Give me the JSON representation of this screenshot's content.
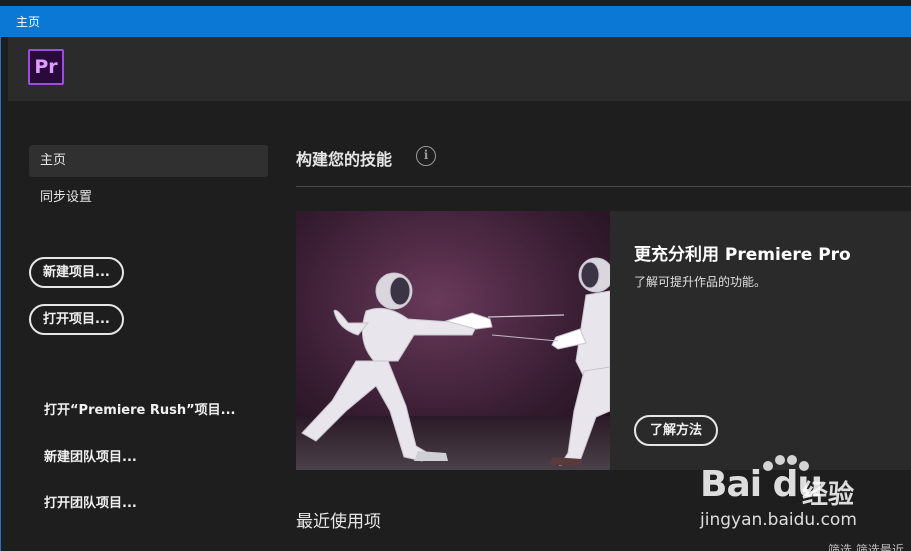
{
  "window": {
    "title": "主页"
  },
  "app": {
    "logo_text": "Pr"
  },
  "sidebar": {
    "items": [
      {
        "label": "主页",
        "active": true
      },
      {
        "label": "同步设置",
        "active": false
      }
    ],
    "buttons": [
      {
        "label": "新建项目..."
      },
      {
        "label": "打开项目..."
      }
    ],
    "links": [
      {
        "label": "打开“Premiere Rush”项目..."
      },
      {
        "label": "新建团队项目..."
      },
      {
        "label": "打开团队项目..."
      }
    ]
  },
  "main": {
    "section_title": "构建您的技能",
    "info_icon": "info-icon",
    "card": {
      "title": "更充分利用 Premiere Pro",
      "description": "了解可提升作品的功能。",
      "button_label": "了解方法"
    },
    "recent_title": "最近使用项",
    "filter_text": "筛选 筛选最近"
  },
  "watermark": {
    "brand": "Bai du",
    "product": "经验",
    "url": "jingyan.baidu.com"
  },
  "colors": {
    "titlebar": "#0a78d4",
    "background": "#1e1e1e",
    "header": "#2b2b2b",
    "logo_border": "#9b4de0"
  }
}
